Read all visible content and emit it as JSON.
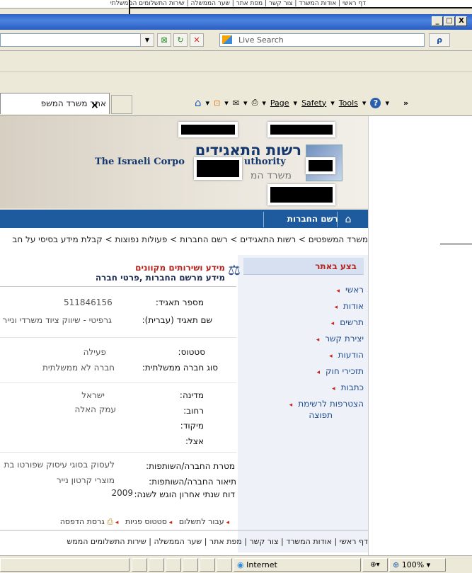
{
  "top_links": "דף ראשי | אודות המשרד | צור קשר | מפת אתר | שער הממשלה | שירות התשלומים הממשלתי",
  "window": {
    "min": "_",
    "max": "□",
    "close": "X"
  },
  "search": {
    "placeholder": "Live Search",
    "go": "ρ"
  },
  "tab": {
    "title": "אתר משרד המשפ",
    "close": "×"
  },
  "command_bar": {
    "home": "⌂",
    "feeds": "⊡",
    "mail": "✉",
    "print": "⎙",
    "page": "Page",
    "safety": "Safety",
    "tools": "Tools",
    "help": "?",
    "more": "»"
  },
  "banner": {
    "heb_title": "רשות התאגידים",
    "eng_title": "The Israeli Corpo",
    "eng_title_tail": "uthority",
    "heb_sub": "משרד המ"
  },
  "nav": {
    "label": "רשם החברות",
    "home": "⌂"
  },
  "breadcrumbs": "משרד המשפטים > רשות התאגידים > רשם החברות > פעולות נפוצות > קבלת מידע בסיסי על חב",
  "sidebar": {
    "heading": "בצע באתר",
    "items": [
      {
        "label": "ראשי"
      },
      {
        "label": "אודות"
      },
      {
        "label": "תרשים"
      },
      {
        "label": "יצירת קשר"
      },
      {
        "label": "הודעות"
      },
      {
        "label": "תזכירי חוק"
      },
      {
        "label": "כתבות"
      },
      {
        "label": "הצטרפות לרשימת"
      },
      {
        "label": "תפוצה"
      }
    ]
  },
  "content": {
    "head1": "מידע ושירותים מקוונים",
    "head2": "מידע מרשם החברות ,פרטי חברה",
    "fields": {
      "corp_no_label": "מספר תאגיד:",
      "corp_no_value": "511846156",
      "name_label": "שם תאגיד (עברית):",
      "name_value": "גרפיטי - שיווק ציוד משרדי ונייר",
      "status_label": "סטטוס:",
      "status_value": "פעילה",
      "type_label": "סוג חברה ממשלתית:",
      "type_value": "חברה לא ממשלתית",
      "country_label": "מדינה:",
      "country_value": "ישראל",
      "street_label": "רחוב:",
      "street_value": "עמק האלה",
      "zip_label": "מיקוד:",
      "attn_label": "אצל:",
      "purpose_label": "מטרת החברה/השותפות:",
      "purpose_value": "לעסוק בסוגי עיסוק שפורטו בת",
      "desc_label": "תיאור החברה/השותפות:",
      "desc_value": "מוצרי קרטון נייר",
      "report_label": "דוח שנתי אחרון הוגש לשנה:",
      "report_value": "2009"
    }
  },
  "actions": {
    "pay": "עבור לתשלום",
    "status": "סטטוס פניות",
    "print": "גרסת הדפסה"
  },
  "footer": "דף ראשי | אודות המשרד | צור קשר | מפת אתר | שער הממשלה | שירות התשלומים הממש",
  "statusbar": {
    "zone": "Internet",
    "zoom": "100%"
  }
}
